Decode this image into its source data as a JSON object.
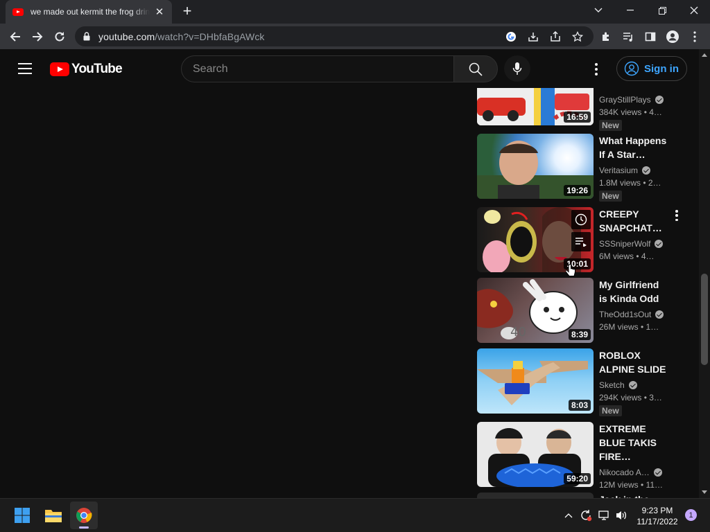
{
  "browser": {
    "tab_title": "we made out kermit the frog drinking",
    "url_host": "youtube.com",
    "url_path": "/watch?v=DHbfaBgAWck"
  },
  "youtube": {
    "logo_text": "YouTube",
    "search_placeholder": "Search",
    "sign_in_label": "Sign in",
    "accent_color": "#ff0000",
    "link_color": "#3ea6ff"
  },
  "videos": [
    {
      "title": "",
      "channel": "GrayStillPlays",
      "views": "384K views  •  4…",
      "duration": "16:59",
      "badge": "New"
    },
    {
      "title": "What Happens If A Star…",
      "channel": "Veritasium",
      "views": "1.8M views  •  2…",
      "duration": "19:26",
      "badge": "New"
    },
    {
      "title": "CREEPY SNAPCHAT…",
      "channel": "SSSniperWolf",
      "views": "6M views  •  4…",
      "duration": "10:01",
      "badge": ""
    },
    {
      "title": "My Girlfriend is Kinda Odd",
      "channel": "TheOdd1sOut",
      "views": "26M views  •  1…",
      "duration": "8:39",
      "badge": ""
    },
    {
      "title": "ROBLOX ALPINE SLIDE",
      "channel": "Sketch",
      "views": "294K views  •  3…",
      "duration": "8:03",
      "badge": "New"
    },
    {
      "title": "EXTREME BLUE TAKIS FIRE…",
      "channel": "Nikocado A…",
      "views": "12M views  •  11…",
      "duration": "59:20",
      "badge": ""
    },
    {
      "title": "Jack in the Box…",
      "channel": "",
      "views": "",
      "duration": "",
      "badge": ""
    }
  ],
  "taskbar": {
    "time": "9:23 PM",
    "date": "11/17/2022",
    "notification_count": "1"
  }
}
